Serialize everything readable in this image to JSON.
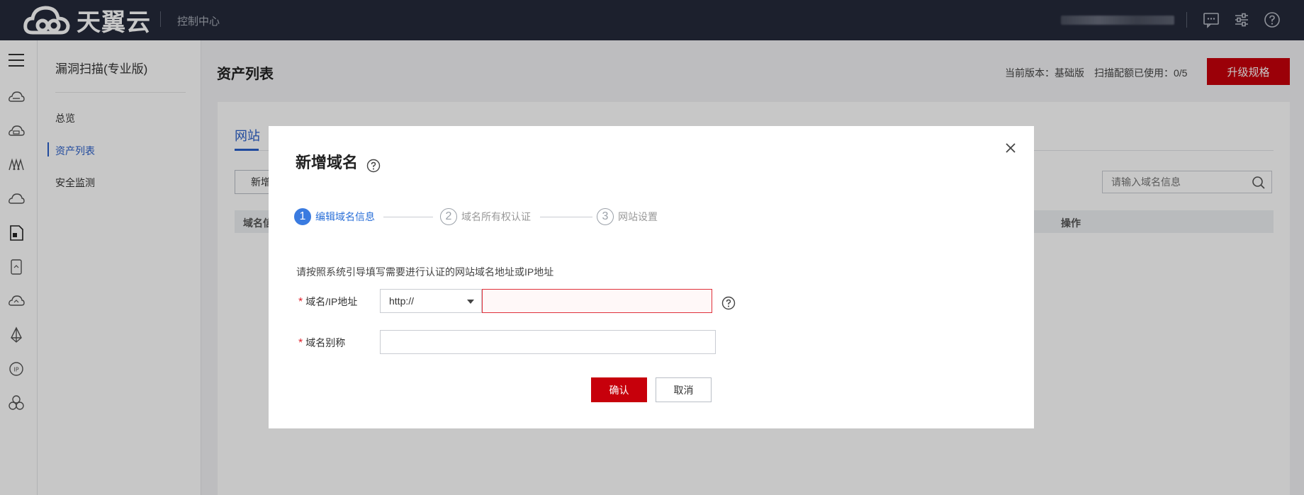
{
  "topbar": {
    "brand": "天翼云",
    "console_label": "控制中心",
    "icons": [
      "message-icon",
      "settings-sliders-icon",
      "help-icon"
    ]
  },
  "rail": {
    "icons": [
      "menu-icon",
      "cloud-host-icon",
      "cloud-disk-icon",
      "network-icon",
      "cloud-icon",
      "document-icon",
      "storage-icon",
      "cloud-sync-icon",
      "diamond-icon",
      "ip-icon",
      "cluster-icon"
    ]
  },
  "sidebar": {
    "title": "漏洞扫描(专业版)",
    "items": [
      {
        "label": "总览"
      },
      {
        "label": "资产列表"
      },
      {
        "label": "安全监测"
      }
    ]
  },
  "main": {
    "title": "资产列表",
    "version_text": "当前版本：基础版　扫描配额已使用：0/5",
    "upgrade_label": "升级规格",
    "tab_label": "网站",
    "add_button_label": "新增",
    "search_placeholder": "请输入域名信息",
    "table_headers": [
      "域名信",
      "操作"
    ]
  },
  "modal": {
    "title": "新增域名",
    "steps": [
      {
        "num": "1",
        "label": "编辑域名信息"
      },
      {
        "num": "2",
        "label": "域名所有权认证"
      },
      {
        "num": "3",
        "label": "网站设置"
      }
    ],
    "guide_text": "请按照系统引导填写需要进行认证的网站域名地址或IP地址",
    "domain_label": "域名/IP地址",
    "protocol_value": "http://",
    "alias_label": "域名别称",
    "required_mark": "*",
    "confirm_label": "确认",
    "cancel_label": "取消"
  },
  "colors": {
    "topbar_bg": "#24293a",
    "accent_red": "#c7000b",
    "accent_blue": "#2a5fc9"
  }
}
